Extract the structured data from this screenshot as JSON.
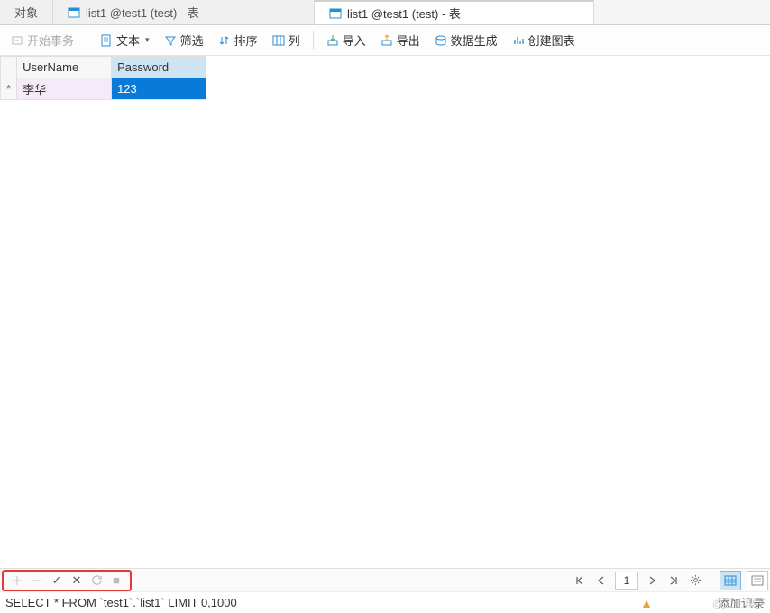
{
  "tabs": {
    "objects": "对象",
    "tab1": "list1 @test1 (test) - 表",
    "tab2": "list1 @test1 (test) - 表"
  },
  "toolbar": {
    "begin_transaction": "开始事务",
    "text": "文本",
    "filter": "筛选",
    "sort": "排序",
    "column": "列",
    "import": "导入",
    "export": "导出",
    "data_gen": "数据生成",
    "create_chart": "创建图表"
  },
  "grid": {
    "headers": {
      "username": "UserName",
      "password": "Password"
    },
    "rows": [
      {
        "username": "李华",
        "password": "123"
      }
    ]
  },
  "footer": {
    "page": "1"
  },
  "status": {
    "sql": "SELECT * FROM `test1`.`list1` LIMIT 0,1000",
    "right": "添加记录"
  },
  "watermark": "@二土电子"
}
